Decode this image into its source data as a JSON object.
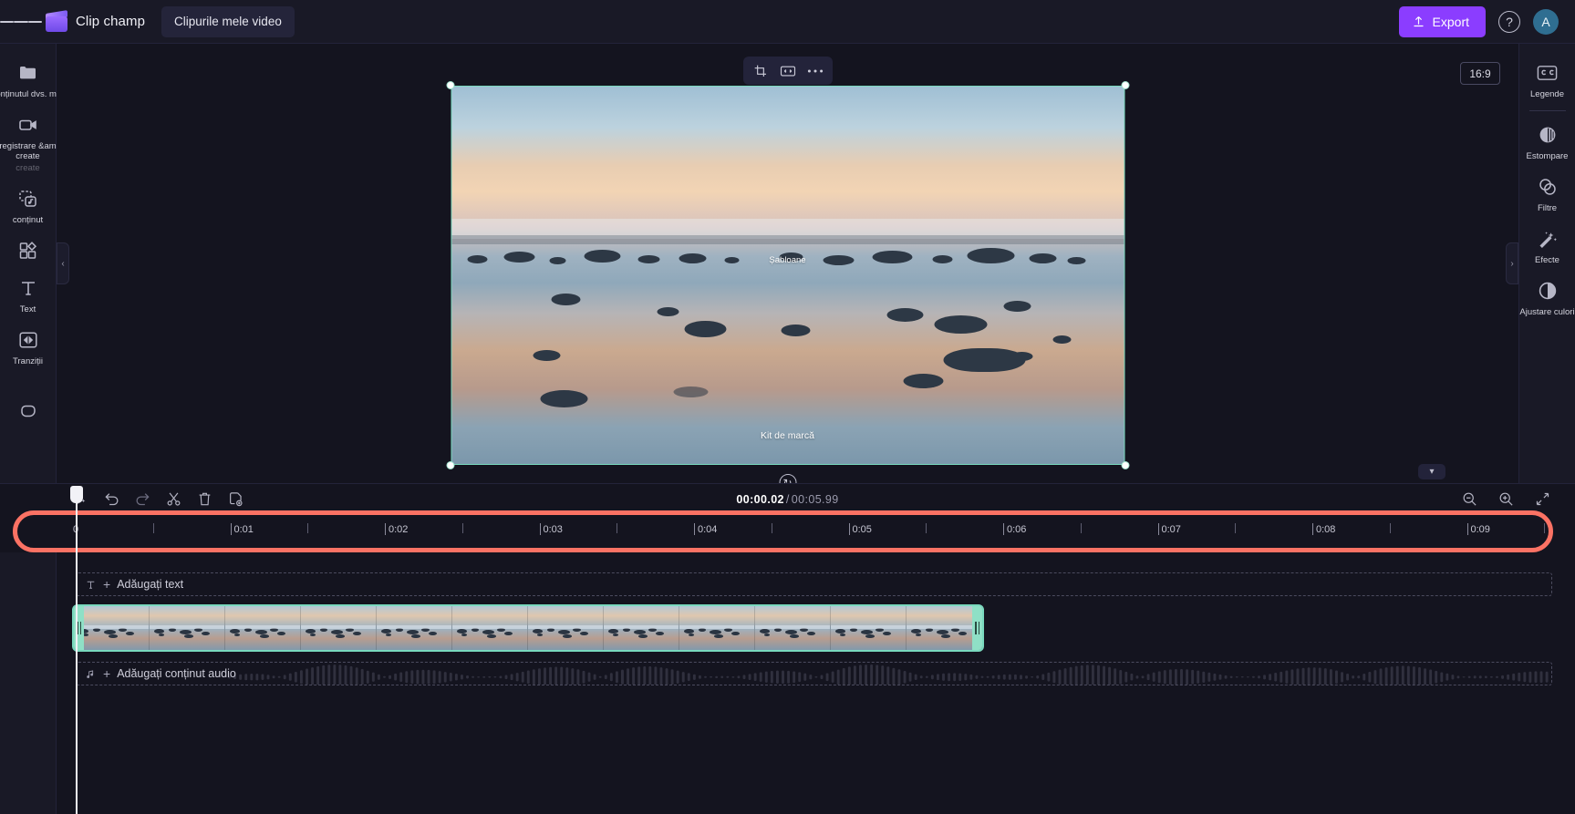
{
  "app": {
    "brand_name": "Clip champ",
    "project_tab": "Clipurile mele video",
    "menu_icon": "hamburger-icon",
    "export_label": "Export",
    "help_label": "?",
    "avatar_initial": "A",
    "accent_purple": "#8b3dff",
    "highlight_red": "#fb7264",
    "selection_teal": "#79d9be"
  },
  "left_rail": {
    "items": [
      {
        "label": "Conținutul dvs. media",
        "icon": "folder-icon"
      },
      {
        "label": "Înregistrare &amp; create",
        "icon": "camera-icon"
      },
      {
        "label": "conținut",
        "icon": "media-library-icon"
      },
      {
        "label": "",
        "icon": "elements-icon"
      },
      {
        "label": "Text",
        "icon": "text-icon"
      },
      {
        "label": "Tranziții",
        "icon": "transitions-icon"
      },
      {
        "label": "",
        "icon": "shapes-icon"
      }
    ]
  },
  "right_rail": {
    "items": [
      {
        "label": "Legende",
        "icon": "captions-cc-icon"
      },
      {
        "label": "Estompare",
        "icon": "blur-icon"
      },
      {
        "label": "Filtre",
        "icon": "filters-icon"
      },
      {
        "label": "Efecte",
        "icon": "effects-wand-icon"
      },
      {
        "label": "Ajustare culori",
        "icon": "color-adjust-icon"
      }
    ]
  },
  "canvas": {
    "aspect_ratio": "16:9",
    "float_tools": [
      {
        "name": "crop-icon"
      },
      {
        "name": "fit-resize-icon"
      },
      {
        "name": "more-options-icon"
      }
    ],
    "overlay_texts": [
      "Șabloane",
      "Kit de marcă"
    ],
    "rotate_glyph": "↻"
  },
  "playback": {
    "captions_off_icon": "captions-off-icon",
    "controls": [
      {
        "name": "skip-to-start-button",
        "glyph": "skip-start"
      },
      {
        "name": "rewind-5s-button",
        "glyph": "back-5"
      },
      {
        "name": "play-button",
        "glyph": "play"
      },
      {
        "name": "forward-5s-button",
        "glyph": "forward-5"
      },
      {
        "name": "skip-to-end-button",
        "glyph": "skip-end"
      }
    ],
    "fullscreen_icon": "fullscreen-icon"
  },
  "timeline": {
    "tools": [
      {
        "name": "magic-sparkle-button",
        "glyph": "sparkle"
      },
      {
        "name": "undo-button",
        "glyph": "undo"
      },
      {
        "name": "redo-button",
        "glyph": "redo"
      },
      {
        "name": "split-scissors-button",
        "glyph": "scissors"
      },
      {
        "name": "delete-button",
        "glyph": "trash"
      },
      {
        "name": "duplicate-button",
        "glyph": "duplicate"
      }
    ],
    "current_time": "00:00.02",
    "time_separator": "/",
    "total_time": "00:05.99",
    "zoom_controls": [
      {
        "name": "zoom-out-button",
        "glyph": "zoom-out"
      },
      {
        "name": "zoom-in-button",
        "glyph": "zoom-in"
      },
      {
        "name": "fit-timeline-button",
        "glyph": "fit"
      }
    ],
    "ruler_labels": [
      "0",
      "0:01",
      "0:02",
      "0:03",
      "0:04",
      "0:05",
      "0:06",
      "0:07",
      "0:08",
      "0:09"
    ],
    "text_track_label": "Adăugați text",
    "audio_track_label": "Adăugați conținut audio",
    "text_track_icon": "text-icon",
    "audio_track_icon": "music-note-icon"
  }
}
